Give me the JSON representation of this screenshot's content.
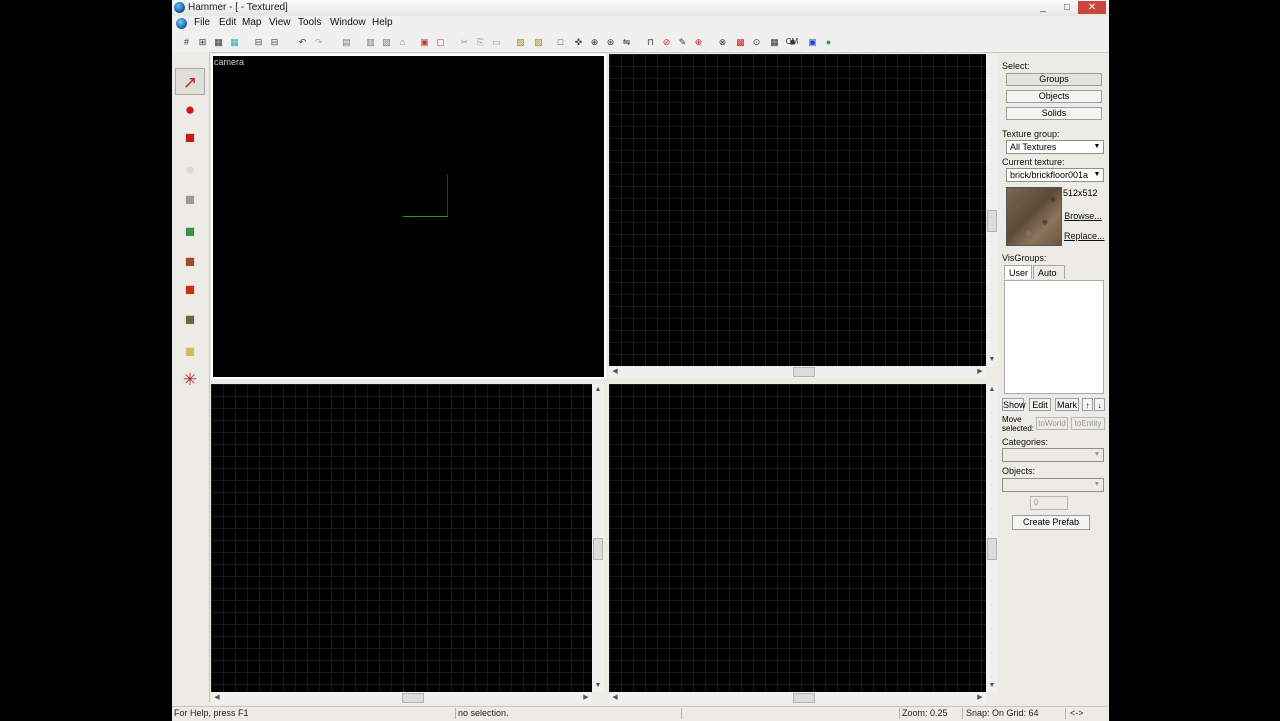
{
  "window": {
    "title": "Hammer - [ - Textured]",
    "controls": [
      "_",
      "□",
      "✕"
    ],
    "mdi_controls": [
      "_",
      "▫",
      "✕"
    ]
  },
  "menu": {
    "items": [
      "File",
      "Edit",
      "Map",
      "View",
      "Tools",
      "Window",
      "Help"
    ]
  },
  "toolbar": {
    "icons": [
      "grid-toggle-icon",
      "grid-3d-icon",
      "grid-smaller-icon",
      "grid-larger-icon",
      "carve-icon",
      "group-icon",
      "undo-icon",
      "redo-icon",
      "hide-icon",
      "hide-unselected-icon",
      "unhide-icon",
      "texture-lock-icon",
      "group-icon",
      "ungroup-icon",
      "cut-icon",
      "copy-icon",
      "paste-icon",
      "toggle-ignore-icon",
      "toggle-auto-icon",
      "selection-box-icon",
      "center-icon",
      "texture-application-icon",
      "model-icon",
      "flip-icon",
      "carve2-icon",
      "clip-icon",
      "vertex-icon",
      "apply-decal-icon",
      "overlay-icon",
      "compile-icon",
      "cubemap-icon",
      "map-properties-icon",
      "check-map-icon",
      "run-icon",
      "green-leaf-icon",
      "alt-draw-icon"
    ],
    "cm_label": "CM"
  },
  "left_tools": {
    "items": [
      {
        "name": "selection-tool-icon",
        "glyph": "↗",
        "color": "#c42020"
      },
      {
        "name": "magnify-tool-icon",
        "glyph": "●",
        "color": "#cc1a1a"
      },
      {
        "name": "camera-tool-icon",
        "glyph": "■",
        "color": "#c41b1b"
      },
      {
        "name": "entity-tool-icon",
        "glyph": "●",
        "color": "#d8d8d8"
      },
      {
        "name": "block-tool-icon",
        "glyph": "■",
        "color": "#9a9a9a"
      },
      {
        "name": "texture-tool-icon",
        "glyph": "■",
        "color": "#3f8f4a"
      },
      {
        "name": "apply-texture-icon",
        "glyph": "■",
        "color": "#a3482e"
      },
      {
        "name": "decal-tool-icon",
        "glyph": "■",
        "color": "#d02a1a"
      },
      {
        "name": "overlay-tool-icon",
        "glyph": "■",
        "color": "#6b6a38"
      },
      {
        "name": "clipping-tool-icon",
        "glyph": "■",
        "color": "#d6b66a"
      },
      {
        "name": "vertex-tool-icon",
        "glyph": "✳",
        "color": "#b82a2a"
      }
    ]
  },
  "viewports": {
    "camera_label": "camera"
  },
  "right_panel": {
    "select_label": "Select:",
    "select_buttons": [
      "Groups",
      "Objects",
      "Solids"
    ],
    "texture_group_label": "Texture group:",
    "texture_group_value": "All Textures",
    "current_texture_label": "Current texture:",
    "current_texture_value": "brick/brickfloor001a",
    "texture_size": "512x512",
    "browse_label": "Browse...",
    "replace_label": "Replace...",
    "visgroups_label": "VisGroups:",
    "tab_user": "User",
    "tab_auto": "Auto",
    "vis_buttons": [
      "Show",
      "Edit",
      "Mark"
    ],
    "move_selected_label": "Move selected:",
    "to_world": "toWorld",
    "to_entity": "toEntity",
    "categories_label": "Categories:",
    "objects_label": "Objects:",
    "faces_value": "0",
    "create_prefab": "Create Prefab"
  },
  "status": {
    "help": "For Help, press F1",
    "selection": "no selection.",
    "zoom": "Zoom: 0.25",
    "snap": "Snap: On Grid: 64",
    "arrows": "<->"
  },
  "colors": {
    "axis_x": "#1aa31a",
    "axis_y": "#2525cc",
    "grid": "#1a1a1a",
    "accent": "#c42020"
  }
}
